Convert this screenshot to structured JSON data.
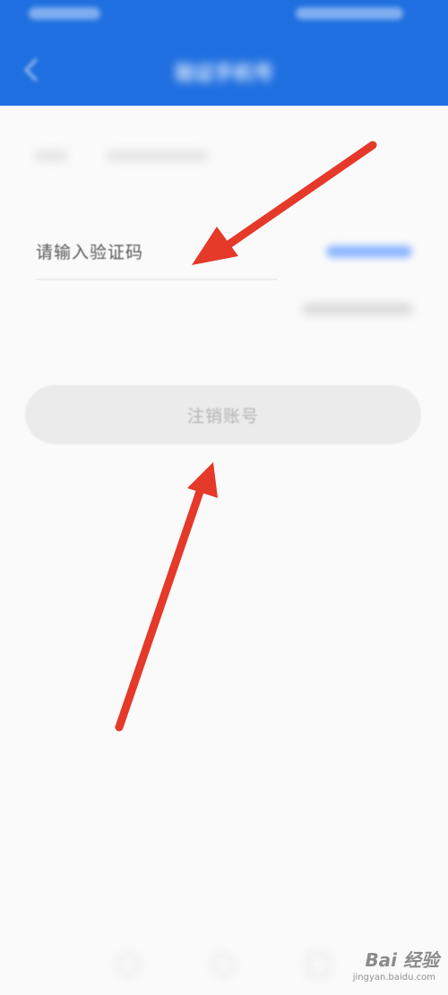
{
  "header": {
    "title": "验证手机号"
  },
  "form": {
    "phone_prefix": "+86",
    "phone_number": "183****5488",
    "code_placeholder": "请输入验证码",
    "get_code_label": "获取验证码",
    "tip_text": "收不到验证码？",
    "cancel_button_label": "注销账号"
  },
  "watermark": {
    "main": "Bai 经验",
    "sub": "jingyan.baidu.com"
  },
  "colors": {
    "header": "#1f6fe0",
    "arrow": "#e5392a",
    "button_bg": "#ebebeb"
  }
}
